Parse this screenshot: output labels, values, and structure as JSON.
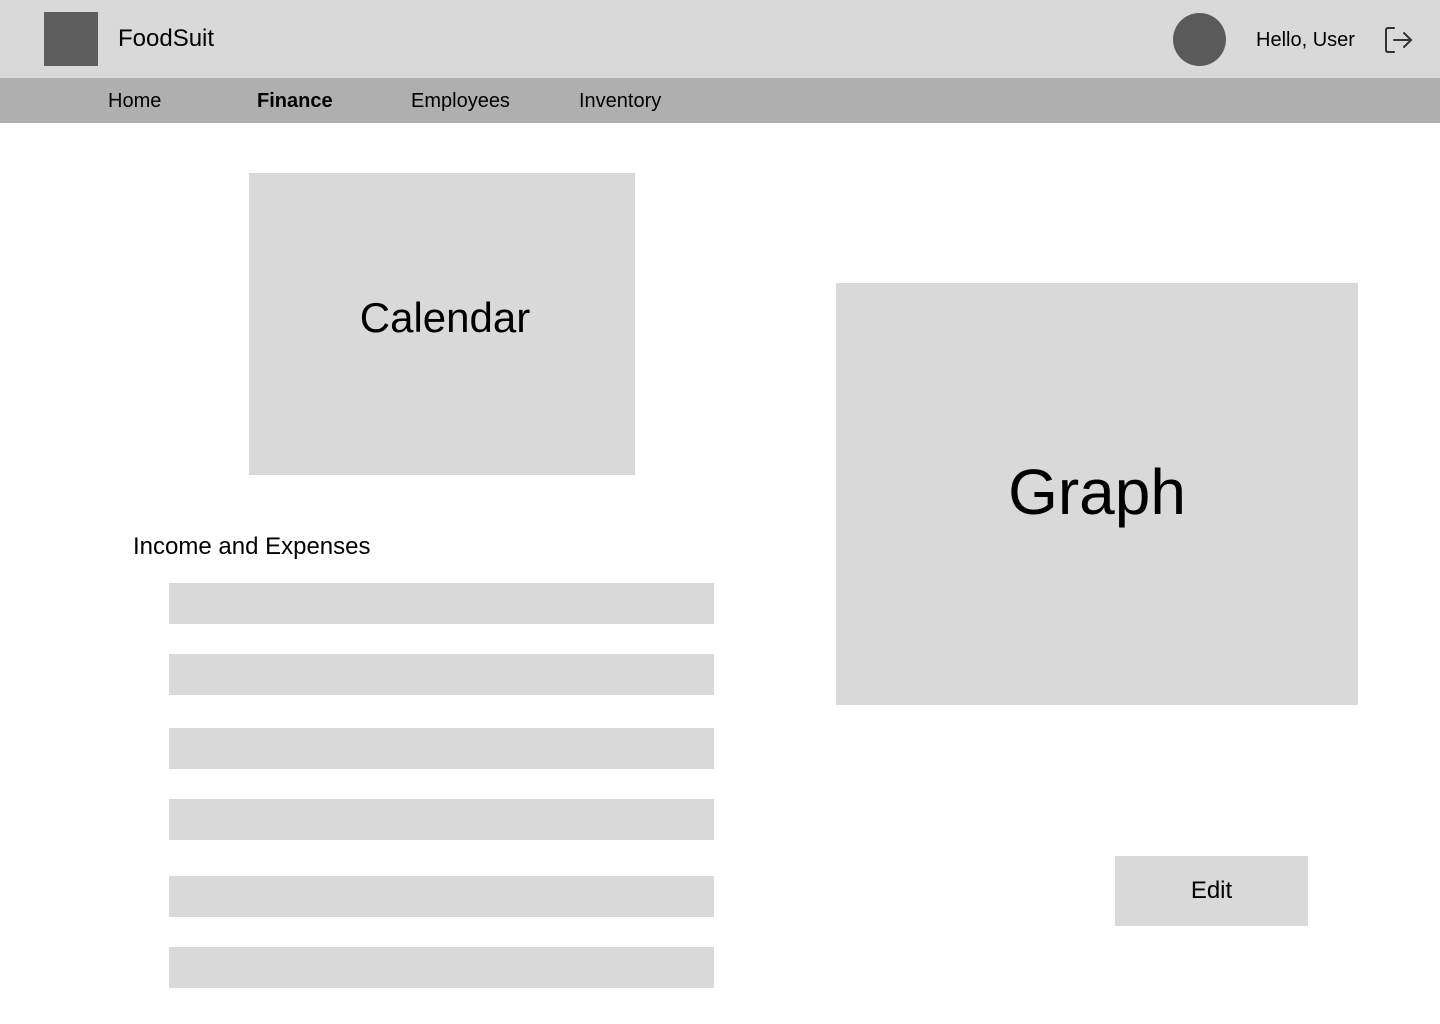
{
  "header": {
    "app_name": "FoodSuit",
    "greeting": "Hello, User",
    "logo_icon": "app-logo",
    "avatar_icon": "user-avatar",
    "logout_icon": "logout-icon"
  },
  "nav": {
    "items": [
      {
        "label": "Home",
        "active": false
      },
      {
        "label": "Finance",
        "active": true
      },
      {
        "label": "Employees",
        "active": false
      },
      {
        "label": "Inventory",
        "active": false
      }
    ]
  },
  "main": {
    "calendar_label": "Calendar",
    "graph_label": "Graph",
    "income_expenses": {
      "title": "Income and Expenses",
      "row_count": 6
    },
    "edit_label": "Edit"
  },
  "colors": {
    "topbar": "#d9d9d9",
    "navbar": "#afafaf",
    "placeholder": "#d9d9d9",
    "logo": "#5d5d5d",
    "avatar": "#5a5a5a"
  }
}
